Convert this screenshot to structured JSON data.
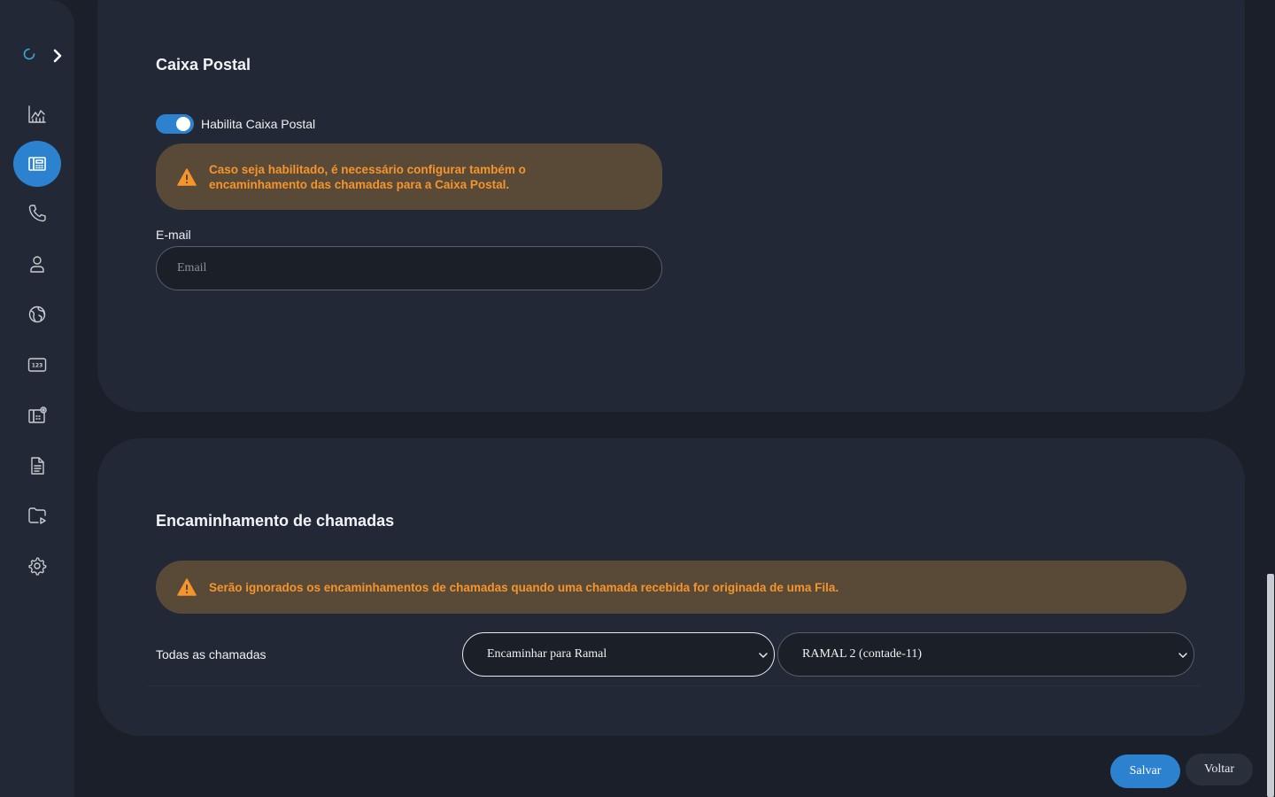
{
  "sidebar": {
    "items": [
      {
        "icon": "chart-icon"
      },
      {
        "icon": "fax-icon",
        "active": true
      },
      {
        "icon": "phone-icon"
      },
      {
        "icon": "user-icon"
      },
      {
        "icon": "globe-icon"
      },
      {
        "icon": "numpad-icon"
      },
      {
        "icon": "fax-settings-icon"
      },
      {
        "icon": "document-icon"
      },
      {
        "icon": "folder-play-icon"
      },
      {
        "icon": "gear-icon"
      }
    ]
  },
  "voicemail": {
    "title": "Caixa Postal",
    "toggle_label": "Habilita Caixa Postal",
    "toggle_on": true,
    "alert": "Caso seja habilitado, é necessário configurar também o encaminhamento das chamadas para a Caixa Postal.",
    "email_label": "E-mail",
    "email_placeholder": "Email",
    "email_value": ""
  },
  "forwarding": {
    "title": "Encaminhamento de chamadas",
    "alert": "Serão ignorados os encaminhamentos de chamadas quando uma chamada recebida for originada de uma Fila.",
    "row_label": "Todas as chamadas",
    "action_select": "Encaminhar para Ramal",
    "target_select": "RAMAL 2 (contade-11)"
  },
  "actions": {
    "save": "Salvar",
    "back": "Voltar"
  },
  "colors": {
    "accent": "#2c82cf",
    "warning_text": "#f6942c",
    "warning_bg": "#594a38"
  }
}
